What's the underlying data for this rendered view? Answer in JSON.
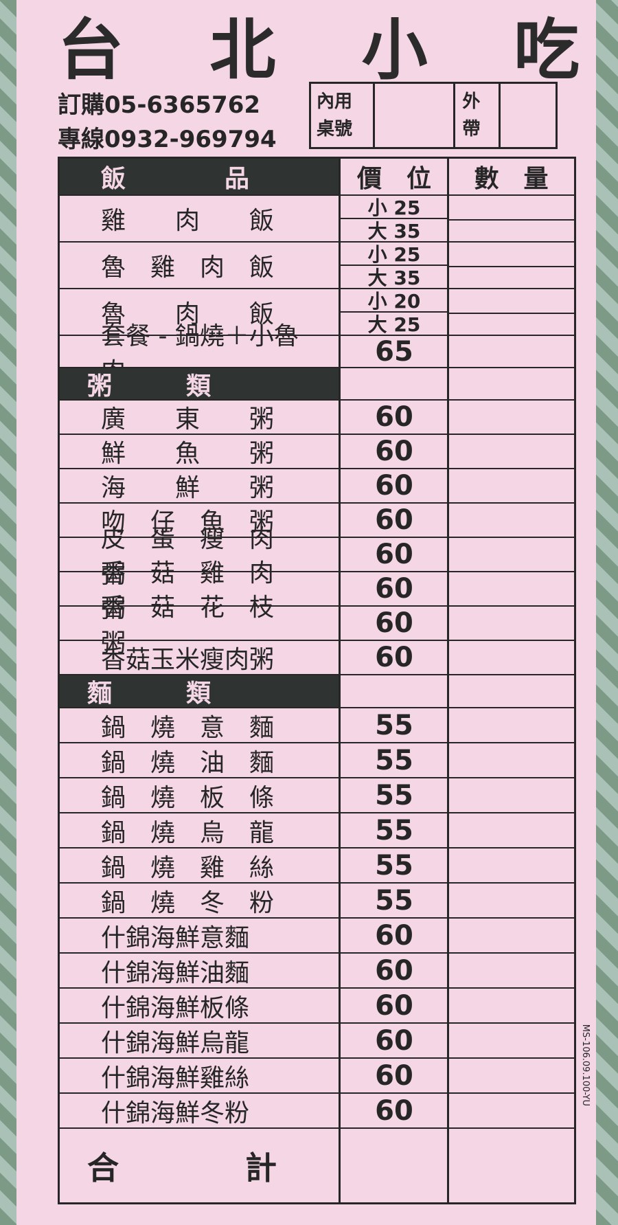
{
  "title_chars": [
    "台",
    "北",
    "小",
    "吃"
  ],
  "order_line": "訂購05-6365762",
  "hotline": "專線0932-969794",
  "box": {
    "dine_in": "內用桌號",
    "takeout": "外帶"
  },
  "headers": {
    "item": "飯　　　　品",
    "price": "價　位",
    "qty": "數　量"
  },
  "rice": [
    {
      "name": "雞　　肉　　飯",
      "small": "小 25",
      "large": "大 35"
    },
    {
      "name": "魯　雞　肉　飯",
      "small": "小 25",
      "large": "大 35"
    },
    {
      "name": "魯　　肉　　飯",
      "small": "小 20",
      "large": "大 25"
    }
  ],
  "combo": {
    "name": "套餐 - 鍋燒＋小魯肉",
    "price": "65"
  },
  "congee_header": "粥　　　類",
  "congee": [
    {
      "name": "廣　　東　　粥",
      "price": "60"
    },
    {
      "name": "鮮　　魚　　粥",
      "price": "60"
    },
    {
      "name": "海　　鮮　　粥",
      "price": "60"
    },
    {
      "name": "吻　仔　魚　粥",
      "price": "60"
    },
    {
      "name": "皮　蛋　瘦　肉　粥",
      "price": "60"
    },
    {
      "name": "香　菇　雞　肉　粥",
      "price": "60"
    },
    {
      "name": "香　菇　花　枝　粥",
      "price": "60"
    },
    {
      "name": "香菇玉米瘦肉粥",
      "price": "60"
    }
  ],
  "noodle_header": "麵　　　類",
  "noodles": [
    {
      "name": "鍋　燒　意　麵",
      "price": "55"
    },
    {
      "name": "鍋　燒　油　麵",
      "price": "55"
    },
    {
      "name": "鍋　燒　板　條",
      "price": "55"
    },
    {
      "name": "鍋　燒　烏　龍",
      "price": "55"
    },
    {
      "name": "鍋　燒　雞　絲",
      "price": "55"
    },
    {
      "name": "鍋　燒　冬　粉",
      "price": "55"
    },
    {
      "name": "什錦海鮮意麵",
      "price": "60"
    },
    {
      "name": "什錦海鮮油麵",
      "price": "60"
    },
    {
      "name": "什錦海鮮板條",
      "price": "60"
    },
    {
      "name": "什錦海鮮烏龍",
      "price": "60"
    },
    {
      "name": "什錦海鮮雞絲",
      "price": "60"
    },
    {
      "name": "什錦海鮮冬粉",
      "price": "60"
    }
  ],
  "total": "合　　　　計",
  "form_code": "MS-106.09.100-YU"
}
